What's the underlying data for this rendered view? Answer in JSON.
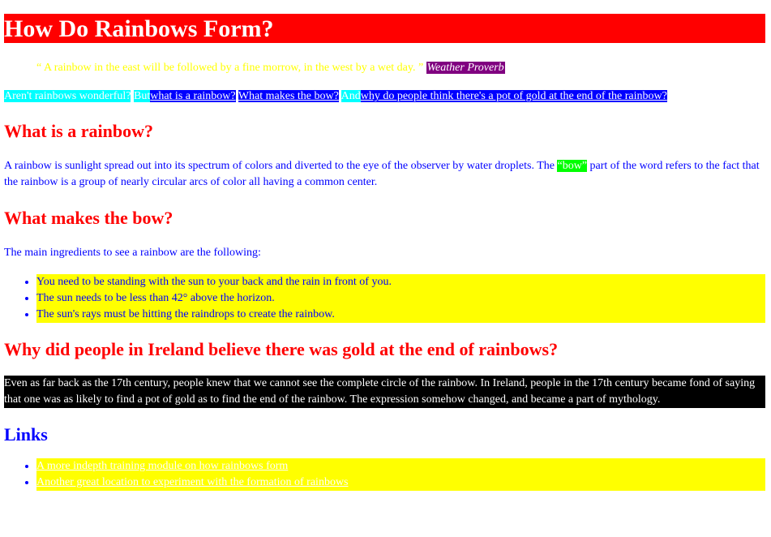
{
  "page": {
    "title": "How Do Rainbows Form?"
  },
  "quote": {
    "text": "“ A rainbow in the east will be followed by a fine morrow, in the west by a wet day. ”",
    "cite": "Weather Proverb"
  },
  "nav": {
    "intro": "Aren't rainbows wonderful?",
    "but": "But",
    "link_rainbow": "what is a rainbow?",
    "link_bow": "What makes the bow?",
    "and": "And",
    "link_gold": "why do people think there's a pot of gold at the end of the rainbow?"
  },
  "sections": {
    "rainbow": {
      "heading": "What is a rainbow?",
      "text_before": "A rainbow is sunlight spread out into its spectrum of colors and diverted to the eye of the observer by water droplets. The ",
      "highlight": "“bow”",
      "text_after": " part of the word refers to the fact that the rainbow is a group of nearly circular arcs of color all having a common center."
    },
    "bow": {
      "heading": "What makes the bow?",
      "intro": "The main ingredients to see a rainbow are the following:",
      "items": [
        "You need to be standing with the sun to your back and the rain in front of you.",
        "The sun needs to be less than 42° above the horizon.",
        "The sun's rays must be hitting the raindrops to create the rainbow."
      ]
    },
    "gold": {
      "heading": "Why did people in Ireland believe there was gold at the end of rainbows?",
      "text": "Even as far back as the 17th century, people knew that we cannot see the complete circle of the rainbow. In Ireland, people in the 17th century became fond of saying that one was as likely to find a pot of gold as to find the end of the rainbow. The expression somehow changed, and became a part of mythology."
    },
    "links": {
      "heading": "Links",
      "items": [
        "A more indepth training module on how rainbows form",
        "Another great location to experiment with the formation of rainbows"
      ]
    }
  },
  "colors": {
    "heading_red": "#ff0000",
    "body_blue": "#0000ff",
    "quote_yellow": "#ffff00",
    "cite_purple": "#800080",
    "nav_cyan": "#00ffff",
    "highlight_green": "#00ff00",
    "list_yellow": "#ffff00",
    "gold_black": "#000000"
  }
}
